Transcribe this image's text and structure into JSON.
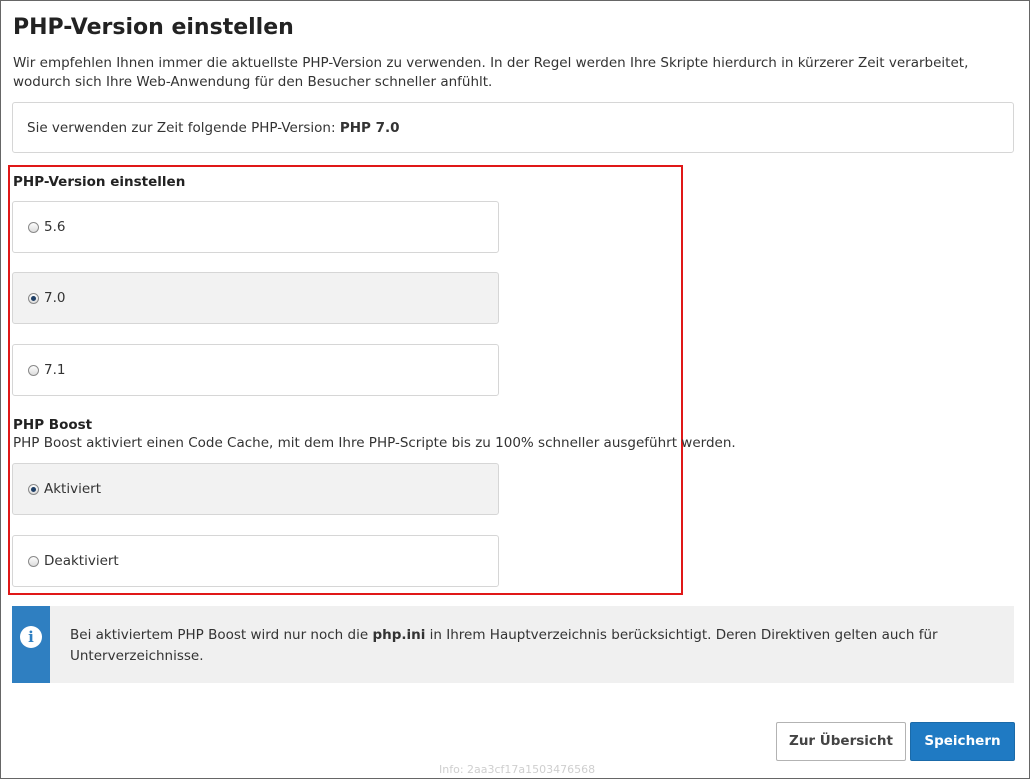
{
  "page": {
    "title": "PHP-Version einstellen",
    "intro": "Wir empfehlen Ihnen immer die aktuellste PHP-Version zu verwenden. In der Regel werden Ihre Skripte hierdurch in kürzerer Zeit verarbeitet, wodurch sich Ihre Web-Anwendung für den Besucher schneller anfühlt."
  },
  "current": {
    "label": "Sie verwenden zur Zeit folgende PHP-Version:",
    "value": "PHP 7.0"
  },
  "php_version": {
    "label": "PHP-Version einstellen",
    "options": [
      {
        "label": "5.6",
        "selected": false
      },
      {
        "label": "7.0",
        "selected": true
      },
      {
        "label": "7.1",
        "selected": false
      }
    ]
  },
  "php_boost": {
    "label": "PHP Boost",
    "description": "PHP Boost aktiviert einen Code Cache, mit dem Ihre PHP-Scripte bis zu 100% schneller ausgeführt werden.",
    "options": [
      {
        "label": "Aktiviert",
        "selected": true
      },
      {
        "label": "Deaktiviert",
        "selected": false
      }
    ]
  },
  "info": {
    "icon": "info-icon",
    "text_before": "Bei aktiviertem PHP Boost wird nur noch die ",
    "text_bold": "php.ini",
    "text_after": " in Ihrem Hauptverzeichnis berücksichtigt. Deren Direktiven gelten auch für Unterverzeichnisse."
  },
  "buttons": {
    "back": "Zur Übersicht",
    "save": "Speichern"
  },
  "footer": {
    "info": "Info: 2aa3cf17a1503476568"
  },
  "colors": {
    "accent": "#1f7ac3",
    "highlight_border": "#e01818",
    "info_bar": "#2f7fc1"
  }
}
